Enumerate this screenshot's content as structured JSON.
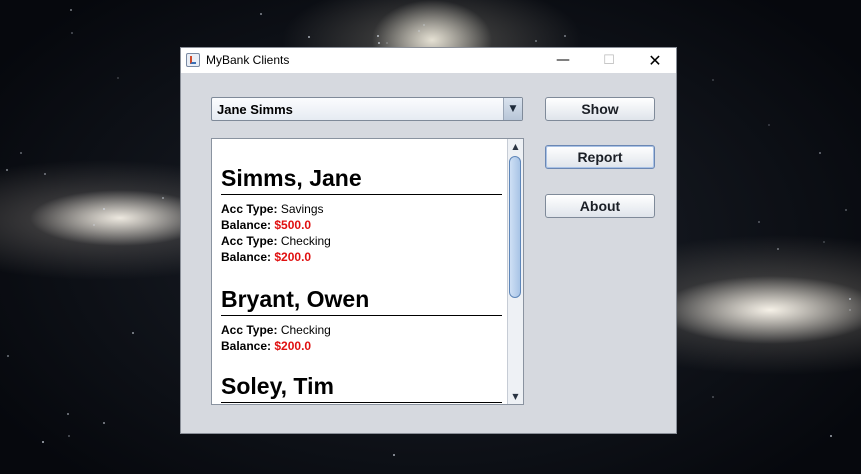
{
  "window": {
    "title": "MyBank Clients",
    "controls": {
      "minimize": "—",
      "maximize": "☐",
      "close": "✕"
    }
  },
  "combo": {
    "selected": "Jane Simms",
    "arrow": "▼"
  },
  "buttons": {
    "show": "Show",
    "report": "Report",
    "about": "About"
  },
  "report": {
    "acc_type_label": "Acc Type:",
    "balance_label": "Balance:",
    "clients": [
      {
        "name": "Simms, Jane",
        "accounts": [
          {
            "type": "Savings",
            "balance": "$500.0"
          },
          {
            "type": "Checking",
            "balance": "$200.0"
          }
        ]
      },
      {
        "name": "Bryant, Owen",
        "accounts": [
          {
            "type": "Checking",
            "balance": "$200.0"
          }
        ]
      },
      {
        "name": "Soley, Tim",
        "accounts": []
      }
    ]
  },
  "scrollbar": {
    "up": "▲",
    "down": "▼"
  },
  "colors": {
    "balance": "#e01010",
    "window_bg": "#d6d9df"
  }
}
